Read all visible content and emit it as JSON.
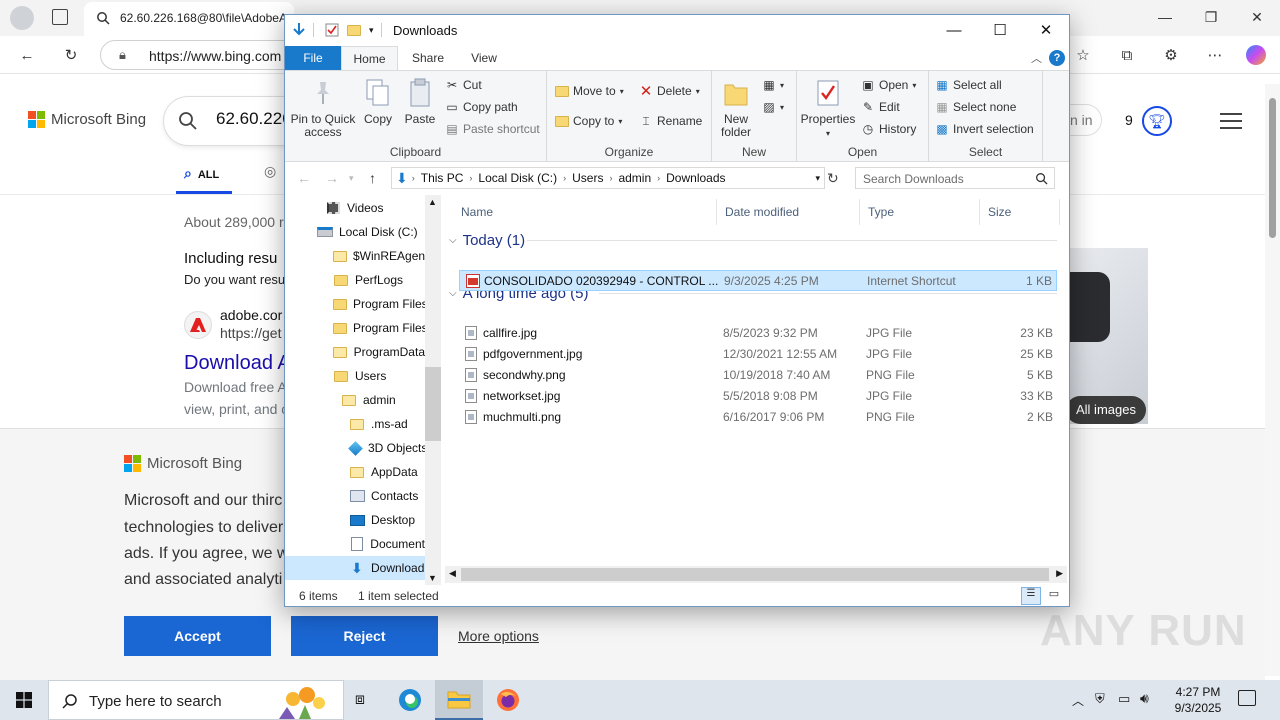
{
  "edge": {
    "tab_title": "62.60.226.168@80\\file\\AdobeA",
    "address": "https://www.bing.com",
    "scroll": {
      "position": 0.03
    }
  },
  "bing": {
    "brand": "Microsoft Bing",
    "query": "62.60.226",
    "tab_all": "ALL",
    "about": "About 289,000 r",
    "including": "Including resu",
    "do_you_want": "Do you want resu",
    "result_site": "adobe.cor",
    "result_url": "https://get",
    "result_title": "Download A",
    "result_desc1": "Download free A",
    "result_desc2": "view, print, and c",
    "sign_in": "n in",
    "points": "9",
    "all_images": "All images"
  },
  "cookie": {
    "brand": "Microsoft Bing",
    "lines": [
      "Microsoft and our thirc",
      "technologies to deliver",
      "ads. If you agree, we w",
      "and associated analyti"
    ],
    "accept": "Accept",
    "reject": "Reject",
    "more": "More options"
  },
  "explorer": {
    "title": "Downloads",
    "tabs": {
      "file": "File",
      "home": "Home",
      "share": "Share",
      "view": "View"
    },
    "ribbon": {
      "clipboard": {
        "label": "Clipboard",
        "pin": "Pin to Quick access",
        "copy": "Copy",
        "paste": "Paste",
        "cut": "Cut",
        "copy_path": "Copy path",
        "paste_shortcut": "Paste shortcut"
      },
      "organize": {
        "label": "Organize",
        "move_to": "Move to",
        "copy_to": "Copy to",
        "delete": "Delete",
        "rename": "Rename"
      },
      "new": {
        "label": "New",
        "new_folder": "New folder"
      },
      "open": {
        "label": "Open",
        "properties": "Properties",
        "open": "Open",
        "edit": "Edit",
        "history": "History"
      },
      "select": {
        "label": "Select",
        "select_all": "Select all",
        "select_none": "Select none",
        "invert": "Invert selection"
      }
    },
    "breadcrumb": [
      "This PC",
      "Local Disk (C:)",
      "Users",
      "admin",
      "Downloads"
    ],
    "search_placeholder": "Search Downloads",
    "nav": [
      {
        "label": "Videos",
        "icon": "videos-icon",
        "indent": 1
      },
      {
        "label": "Local Disk (C:)",
        "icon": "drive-icon",
        "indent": 0
      },
      {
        "label": "$WinREAgent",
        "icon": "folder-icon",
        "indent": 2,
        "light": true
      },
      {
        "label": "PerfLogs",
        "icon": "folder-icon",
        "indent": 2
      },
      {
        "label": "Program Files",
        "icon": "folder-icon",
        "indent": 2
      },
      {
        "label": "Program Files",
        "icon": "folder-icon",
        "indent": 2
      },
      {
        "label": "ProgramData",
        "icon": "folder-icon",
        "indent": 2,
        "light": true
      },
      {
        "label": "Users",
        "icon": "folder-icon",
        "indent": 2
      },
      {
        "label": "admin",
        "icon": "folder-icon",
        "indent": 3,
        "light": true
      },
      {
        "label": ".ms-ad",
        "icon": "folder-icon",
        "indent": 4,
        "light": true
      },
      {
        "label": "3D Objects",
        "icon": "3d-objects-icon",
        "indent": 4
      },
      {
        "label": "AppData",
        "icon": "folder-icon",
        "indent": 4,
        "light": true
      },
      {
        "label": "Contacts",
        "icon": "contacts-icon",
        "indent": 4
      },
      {
        "label": "Desktop",
        "icon": "desktop-icon",
        "indent": 4
      },
      {
        "label": "Document",
        "icon": "documents-icon",
        "indent": 4
      },
      {
        "label": "Download",
        "icon": "downloads-icon",
        "indent": 4,
        "selected": true
      }
    ],
    "columns": {
      "name": "Name",
      "modified": "Date modified",
      "type": "Type",
      "size": "Size"
    },
    "groups": {
      "today": "Today (1)",
      "long_ago": "A long time ago (5)"
    },
    "today_files": [
      {
        "name": "CONSOLIDADO 020392949 - CONTROL ...",
        "modified": "9/3/2025 4:25 PM",
        "type": "Internet Shortcut",
        "size": "1 KB"
      }
    ],
    "old_files": [
      {
        "name": "callfire.jpg",
        "modified": "8/5/2023 9:32 PM",
        "type": "JPG File",
        "size": "23 KB"
      },
      {
        "name": "pdfgovernment.jpg",
        "modified": "12/30/2021 12:55 AM",
        "type": "JPG File",
        "size": "25 KB"
      },
      {
        "name": "secondwhy.png",
        "modified": "10/19/2018 7:40 AM",
        "type": "PNG File",
        "size": "5 KB"
      },
      {
        "name": "networkset.jpg",
        "modified": "5/5/2018 9:08 PM",
        "type": "JPG File",
        "size": "33 KB"
      },
      {
        "name": "muchmulti.png",
        "modified": "6/16/2017 9:06 PM",
        "type": "PNG File",
        "size": "2 KB"
      }
    ],
    "status": {
      "count": "6 items",
      "selected": "1 item selected"
    }
  },
  "taskbar": {
    "search_placeholder": "Type here to search",
    "time": "4:27 PM",
    "date": "9/3/2025"
  },
  "watermark": "ANY RUN"
}
